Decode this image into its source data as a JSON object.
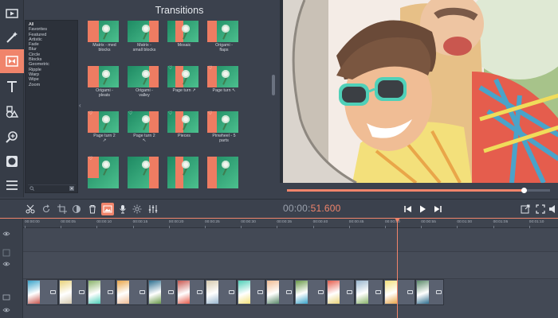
{
  "panel": {
    "title": "Transitions",
    "categories": [
      "All",
      "Favorites",
      "Featured",
      "Artistic",
      "Fade",
      "Blur",
      "Circle",
      "Blocks",
      "Geometric",
      "Ripple",
      "Warp",
      "Wipe",
      "Zoom"
    ],
    "selected_category": "All"
  },
  "transitions": [
    {
      "label": "Matrix - med\nblocks",
      "favorite": false
    },
    {
      "label": "Matrix -\nsmall blocks",
      "favorite": false
    },
    {
      "label": "Mosaic",
      "favorite": false
    },
    {
      "label": "Origami -\nflaps",
      "favorite": false
    },
    {
      "label": "Origami -\npleats",
      "favorite": false
    },
    {
      "label": "Origami -\nvalley",
      "favorite": false
    },
    {
      "label": "Page turn ↗",
      "favorite": true
    },
    {
      "label": "Page turn ↖",
      "favorite": true
    },
    {
      "label": "Page turn 2\n↗",
      "favorite": true
    },
    {
      "label": "Page turn 2\n↖",
      "favorite": true
    },
    {
      "label": "Pieces",
      "favorite": true
    },
    {
      "label": "Pinwheel - 5\nparts",
      "favorite": true
    },
    {
      "label": "",
      "favorite": true
    },
    {
      "label": "",
      "favorite": false
    },
    {
      "label": "",
      "favorite": false
    },
    {
      "label": "",
      "favorite": false
    }
  ],
  "tools": [
    "media-icon",
    "magic-wand-icon",
    "transitions-icon",
    "text-icon",
    "shapes-icon",
    "zoom-icon",
    "record-icon",
    "list-icon"
  ],
  "player": {
    "timecode_main": "00:00:",
    "timecode_highlight": "51.600",
    "progress": 0.9
  },
  "timeline": {
    "ticks": [
      "00:00:00",
      "00:00:05",
      "00:00:10",
      "00:00:15",
      "00:00:20",
      "00:00:25",
      "00:00:30",
      "00:00:35",
      "00:00:40",
      "00:00:45",
      "00:00:50",
      "00:00:55",
      "00:01:00",
      "00:01:05",
      "00:01:10"
    ]
  },
  "colors": {
    "accent": "#f0846b",
    "panel": "#3b414d",
    "thumb_green": "#1e8a63",
    "thumb_coral": "#ee7c62"
  }
}
